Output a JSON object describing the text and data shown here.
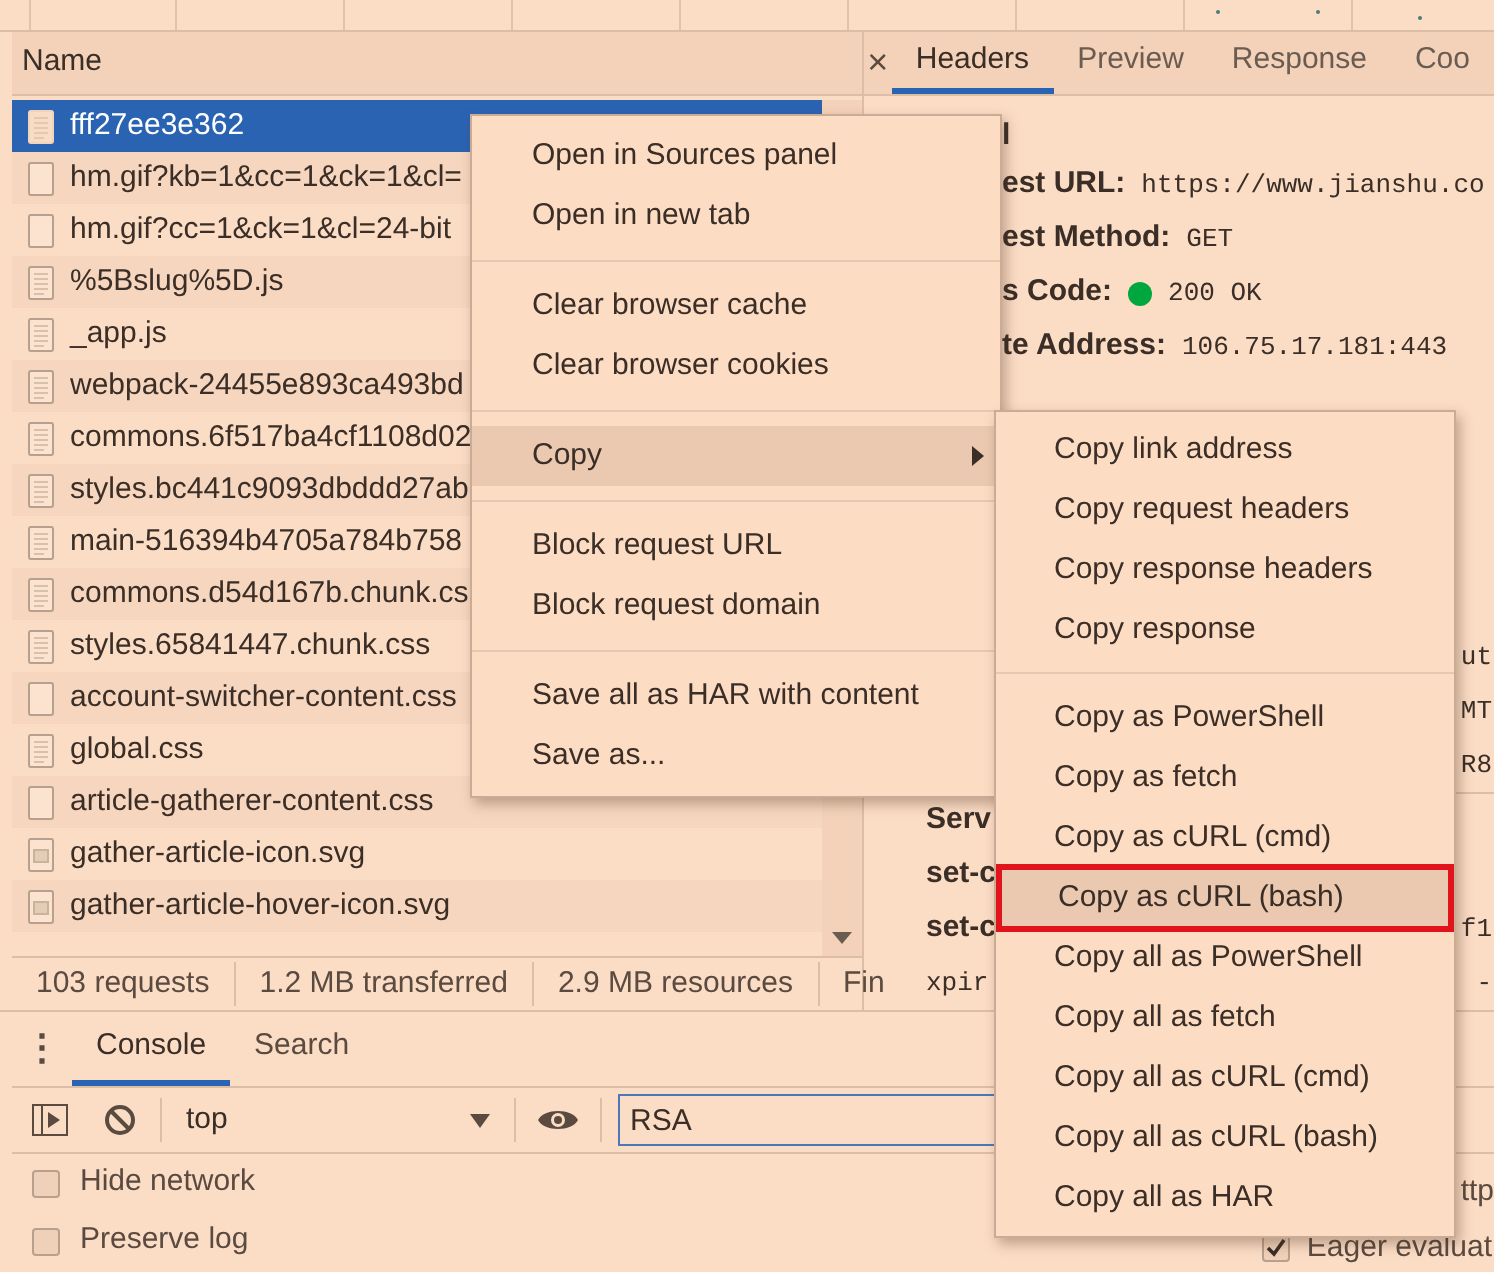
{
  "network": {
    "column_header": "Name",
    "requests": [
      {
        "name": "fff27ee3e362",
        "kind": "document",
        "selected": true
      },
      {
        "name": "hm.gif?kb=1&cc=1&ck=1&cl=",
        "kind": "blank",
        "selected": false
      },
      {
        "name": "hm.gif?cc=1&ck=1&cl=24-bit",
        "kind": "blank",
        "selected": false
      },
      {
        "name": "%5Bslug%5D.js",
        "kind": "document",
        "selected": false
      },
      {
        "name": "_app.js",
        "kind": "document",
        "selected": false
      },
      {
        "name": "webpack-24455e893ca493bd",
        "kind": "document",
        "selected": false
      },
      {
        "name": "commons.6f517ba4cf1108d02",
        "kind": "document",
        "selected": false
      },
      {
        "name": "styles.bc441c9093dbddd27ab",
        "kind": "document",
        "selected": false
      },
      {
        "name": "main-516394b4705a784b758",
        "kind": "document",
        "selected": false
      },
      {
        "name": "commons.d54d167b.chunk.cs",
        "kind": "document",
        "selected": false
      },
      {
        "name": "styles.65841447.chunk.css",
        "kind": "document",
        "selected": false
      },
      {
        "name": "account-switcher-content.css",
        "kind": "blank",
        "selected": false
      },
      {
        "name": "global.css",
        "kind": "document",
        "selected": false
      },
      {
        "name": "article-gatherer-content.css",
        "kind": "blank",
        "selected": false
      },
      {
        "name": "gather-article-icon.svg",
        "kind": "image",
        "selected": false
      },
      {
        "name": "gather-article-hover-icon.svg",
        "kind": "image",
        "selected": false
      }
    ],
    "status_bar": [
      "103 requests",
      "1.2 MB transferred",
      "2.9 MB resources",
      "Fin"
    ]
  },
  "details": {
    "close": "×",
    "tabs": [
      {
        "label": "Headers",
        "selected": true
      },
      {
        "label": "Preview",
        "selected": false
      },
      {
        "label": "Response",
        "selected": false
      },
      {
        "label": "Coo",
        "selected": false
      }
    ],
    "section_title": "l",
    "general": [
      {
        "label": "est URL:",
        "value": "https://www.jianshu.co",
        "status_dot": false
      },
      {
        "label": "est Method:",
        "value": "GET",
        "status_dot": false
      },
      {
        "label": "s Code:",
        "value": "200 OK",
        "status_dot": true
      },
      {
        "label": "te Address:",
        "value": "106.75.17.181:443",
        "status_dot": false
      }
    ],
    "upper_fragments": [
      "ut",
      "MT",
      "R8"
    ],
    "response_headers": [
      {
        "name": "Serv"
      },
      {
        "name": "set-c"
      },
      {
        "name": "set-c",
        "value": "f1"
      },
      {
        "mono_name": "xpir",
        "value": "-"
      }
    ]
  },
  "console": {
    "menu": "⋮",
    "tabs": [
      {
        "label": "Console",
        "selected": true
      },
      {
        "label": "Search",
        "selected": false
      }
    ],
    "context": "top",
    "filter": "RSA",
    "options": [
      {
        "label": "Hide network",
        "checked": false
      },
      {
        "label": "Preserve log",
        "checked": false
      }
    ],
    "right_fragment": "ttp",
    "eager": {
      "label": "Eager evaluat",
      "checked": true
    }
  },
  "context_menu": {
    "groups": [
      [
        {
          "label": "Open in Sources panel",
          "submenu": false,
          "highlighted": false
        },
        {
          "label": "Open in new tab",
          "submenu": false,
          "highlighted": false
        }
      ],
      [
        {
          "label": "Clear browser cache",
          "submenu": false,
          "highlighted": false
        },
        {
          "label": "Clear browser cookies",
          "submenu": false,
          "highlighted": false
        }
      ],
      [
        {
          "label": "Copy",
          "submenu": true,
          "highlighted": true
        }
      ],
      [
        {
          "label": "Block request URL",
          "submenu": false,
          "highlighted": false
        },
        {
          "label": "Block request domain",
          "submenu": false,
          "highlighted": false
        }
      ],
      [
        {
          "label": "Save all as HAR with content",
          "submenu": false,
          "highlighted": false
        },
        {
          "label": "Save as...",
          "submenu": false,
          "highlighted": false
        }
      ]
    ]
  },
  "copy_submenu": {
    "groups": [
      [
        {
          "label": "Copy link address",
          "highlighted": false,
          "boxed": false
        },
        {
          "label": "Copy request headers",
          "highlighted": false,
          "boxed": false
        },
        {
          "label": "Copy response headers",
          "highlighted": false,
          "boxed": false
        },
        {
          "label": "Copy response",
          "highlighted": false,
          "boxed": false
        }
      ],
      [
        {
          "label": "Copy as PowerShell",
          "highlighted": false,
          "boxed": false
        },
        {
          "label": "Copy as fetch",
          "highlighted": false,
          "boxed": false
        },
        {
          "label": "Copy as cURL (cmd)",
          "highlighted": false,
          "boxed": false
        },
        {
          "label": "Copy as cURL (bash)",
          "highlighted": true,
          "boxed": true
        },
        {
          "label": "Copy all as PowerShell",
          "highlighted": false,
          "boxed": false
        },
        {
          "label": "Copy all as fetch",
          "highlighted": false,
          "boxed": false
        },
        {
          "label": "Copy all as cURL (cmd)",
          "highlighted": false,
          "boxed": false
        },
        {
          "label": "Copy all as cURL (bash)",
          "highlighted": false,
          "boxed": false
        },
        {
          "label": "Copy all as HAR",
          "highlighted": false,
          "boxed": false
        }
      ]
    ]
  }
}
